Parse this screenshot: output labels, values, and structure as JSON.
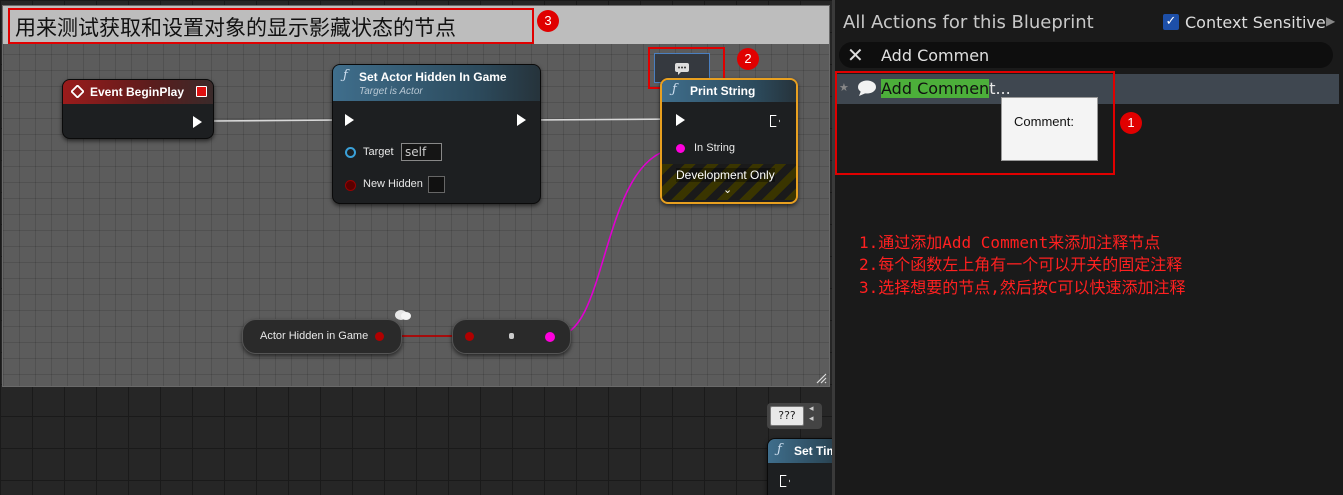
{
  "comment": {
    "title": "用来测试获取和设置对象的显示影藏状态的节点",
    "badge3": "3"
  },
  "badges": {
    "one": "1",
    "two": "2"
  },
  "nodes": {
    "event_begin": {
      "title": "Event BeginPlay"
    },
    "set_hidden": {
      "title": "Set Actor Hidden In Game",
      "subtitle": "Target is Actor",
      "target_label": "Target",
      "target_value": "self",
      "new_hidden_label": "New Hidden"
    },
    "print_string": {
      "title": "Print String",
      "in_string_label": "In String",
      "dev_only": "Development Only"
    },
    "get_hidden": {
      "title": "Actor Hidden in Game"
    },
    "qqq": {
      "label": "???"
    },
    "set_tim": {
      "title": "Set Tim"
    }
  },
  "panel": {
    "title": "All Actions for this Blueprint",
    "context_label": "Context Sensitive",
    "search_value": "Add Commen",
    "result_highlight": "Add Commen",
    "result_bold": "t",
    "result_rest": "...",
    "tooltip": "Comment:"
  },
  "notes": [
    "1.通过添加Add Comment来添加注释节点",
    "2.每个函数左上角有一个可以开关的固定注释",
    "3.选择想要的节点,然后按C可以快速添加注释"
  ],
  "colors": {
    "accent_red": "#e00000",
    "exec_white": "#ffffff",
    "bool_pin": "#8b0000",
    "string_pin": "#ff00dd",
    "highlight_green": "#4caf3a"
  }
}
